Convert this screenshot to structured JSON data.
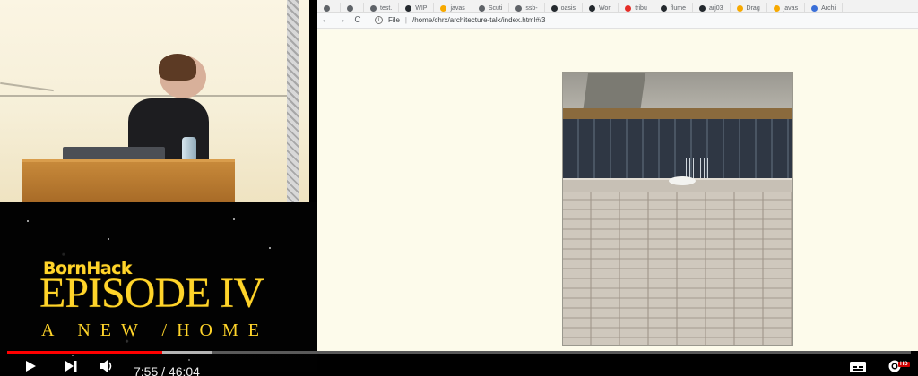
{
  "browser": {
    "tabs": [
      {
        "label": "",
        "color": "#5f6368"
      },
      {
        "label": "",
        "color": "#5f6368"
      },
      {
        "label": "test.",
        "color": "#5f6368"
      },
      {
        "label": "WIP",
        "color": "#24292e"
      },
      {
        "label": "javas",
        "color": "#f7a900"
      },
      {
        "label": "Scuti",
        "color": "#5f6368"
      },
      {
        "label": "ssb-",
        "color": "#5f6368"
      },
      {
        "label": "oasis",
        "color": "#24292e"
      },
      {
        "label": "Worl",
        "color": "#24292e"
      },
      {
        "label": "tribu",
        "color": "#e52d27"
      },
      {
        "label": "flume",
        "color": "#24292e"
      },
      {
        "label": "arj03",
        "color": "#24292e"
      },
      {
        "label": "Drag",
        "color": "#f7a900"
      },
      {
        "label": "javas",
        "color": "#f7a900"
      },
      {
        "label": "Archi",
        "color": "#3a6fd8"
      }
    ],
    "toolbar": {
      "back_icon": "←",
      "forward_icon": "→",
      "reload_icon": "C",
      "info_icon": "i",
      "scheme_label": "File",
      "url_path": "/home/chrx/architecture-talk/index.html#/3"
    }
  },
  "titlecard": {
    "brand": "BornHack",
    "episode": "EPISODE IV",
    "subtitle": "A NEW /HOME"
  },
  "player": {
    "time": "7:55 / 46:04",
    "progress_played_fraction": 0.172,
    "progress_loaded_fraction": 0.226,
    "play_icon": "play-icon",
    "next_icon": "next-icon",
    "volume_icon": "volume-icon",
    "subtitles_icon": "subtitles-icon",
    "settings_icon": "settings-icon",
    "hd_badge": "HD"
  }
}
